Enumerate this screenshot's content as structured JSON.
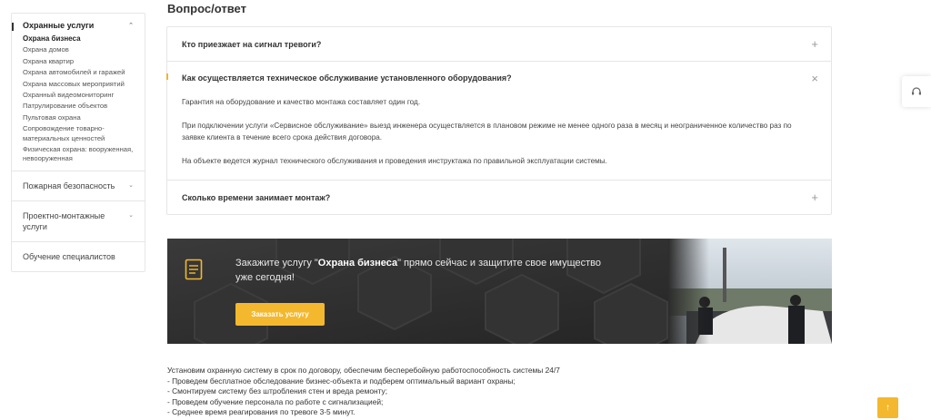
{
  "sidebar": {
    "group1": {
      "label": "Охранные услуги",
      "items": [
        "Охрана бизнеса",
        "Охрана домов",
        "Охрана квартир",
        "Охрана автомобилей и гаражей",
        "Охрана массовых мероприятий",
        "Охранный видеомониторинг",
        "Патрулирование объектов",
        "Пультовая охрана",
        "Сопровождение товарно-материальных ценностей",
        "Физическая охрана: вооруженная, невооруженная"
      ]
    },
    "group2": "Пожарная безопасность",
    "group3": "Проектно-монтажные услуги",
    "group4": "Обучение специалистов"
  },
  "faq": {
    "title": "Вопрос/ответ",
    "items": [
      {
        "question": "Кто приезжает на сигнал тревоги?",
        "toggle": "+"
      },
      {
        "question": "Как осуществляется техническое обслуживание установленного оборудования?",
        "toggle": "×",
        "answer": [
          "Гарантия на оборудование и качество монтажа составляет один год.",
          "При подключении услуги «Сервисное обслуживание» выезд инженера осуществляется в плановом режиме не менее одного раза в месяц и неограниченное количество раз по заявке клиента в течение всего срока действия договора.",
          "На объекте ведется журнал технического обслуживания и проведения инструктажа по правильной эксплуатации системы."
        ]
      },
      {
        "question": "Сколько времени занимает монтаж?",
        "toggle": "+"
      }
    ]
  },
  "banner": {
    "text_before": "Закажите услугу \"",
    "text_bold": "Охрана бизнеса",
    "text_after": "\" прямо сейчас и защитите свое имущество уже сегодня!",
    "button": "Заказать услугу"
  },
  "body": {
    "lines": [
      "Установим охранную систему в срок по договору, обеспечим бесперебойную работоспособность системы 24/7",
      "- Проведем бесплатное обследование бизнес-объекта и подберем оптимальный вариант охраны;",
      "- Смонтируем систему без штробления стен и вреда ремонту;",
      "- Проведем обучение персонала по работе с сигнализацией;",
      "- Среднее время реагирования по тревоге 3-5 минут."
    ]
  },
  "colors": {
    "accent": "#f4b82e",
    "banner_bg": "#2c2c2c"
  },
  "icons": {
    "float": "headset-icon",
    "up": "arrow-up-icon",
    "banner": "document-icon"
  }
}
